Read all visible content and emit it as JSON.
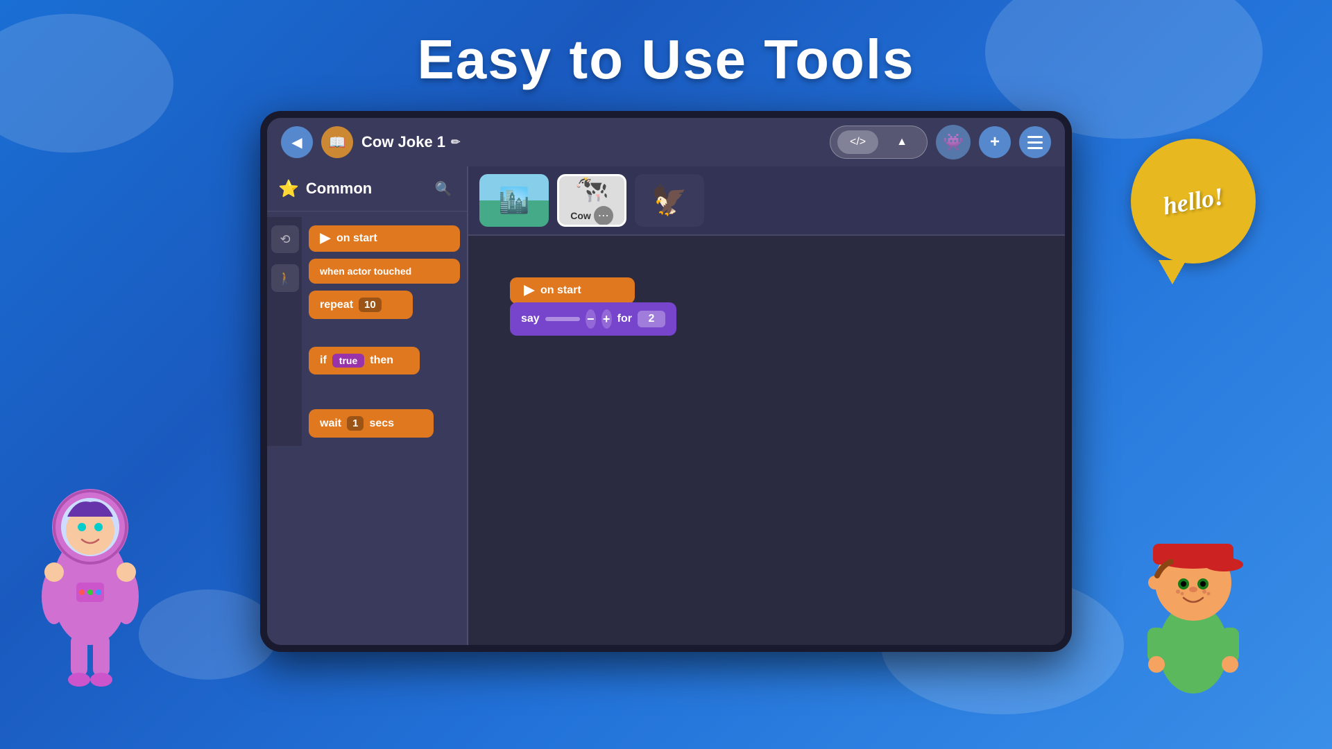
{
  "page": {
    "title": "Easy to Use Tools",
    "background_color": "#1a6fd4"
  },
  "header": {
    "back_button_label": "←",
    "book_icon": "📖",
    "project_name": "Cow Joke 1",
    "edit_icon": "✏",
    "code_view_label": "</>",
    "scene_view_label": "▲",
    "monster_icon": "👾",
    "add_button_label": "+",
    "menu_button_label": "≡"
  },
  "left_panel": {
    "category_icon": "⭐",
    "category_name": "Common",
    "search_icon": "🔍",
    "blocks": [
      {
        "type": "trigger",
        "label": "on start",
        "color": "#E07820"
      },
      {
        "type": "trigger",
        "label": "when actor touched",
        "color": "#E07820"
      },
      {
        "type": "control",
        "label": "repeat",
        "value": "10",
        "color": "#E07820"
      },
      {
        "type": "control",
        "label": "if",
        "bool": "true",
        "suffix": "then",
        "color": "#E07820"
      },
      {
        "type": "action",
        "label": "wait",
        "value": "1",
        "suffix": "secs",
        "color": "#E07820"
      }
    ]
  },
  "sprite_bar": {
    "sprites": [
      {
        "id": "landscape",
        "type": "landscape",
        "label": ""
      },
      {
        "id": "cow",
        "type": "cow",
        "label": "Cow",
        "selected": true
      },
      {
        "id": "bird",
        "type": "bird",
        "label": ""
      }
    ]
  },
  "canvas_blocks": {
    "on_start_label": "on start",
    "say_label": "say",
    "for_label": "for",
    "for_value": "2"
  },
  "speech_bubble": {
    "text": "hello!"
  }
}
